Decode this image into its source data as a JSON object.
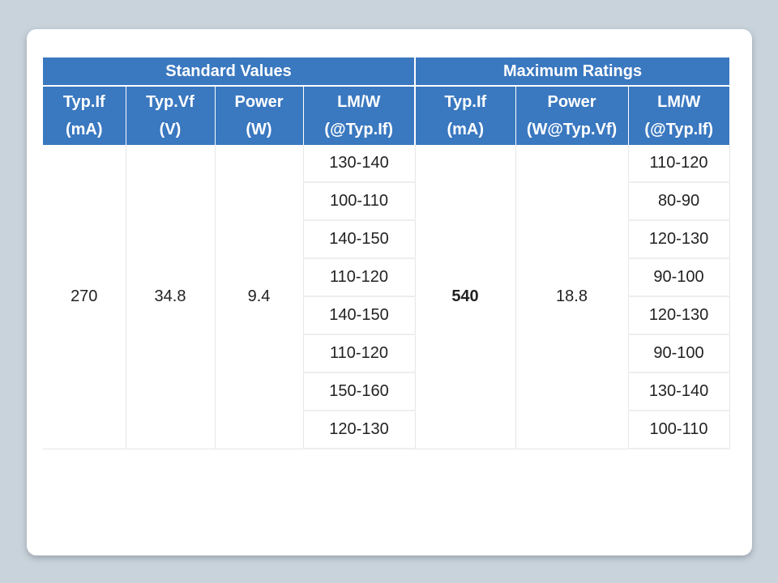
{
  "table": {
    "group_headers": [
      "Standard Values",
      "Maximum Ratings"
    ],
    "columns": [
      [
        "Typ.If",
        "(mA)"
      ],
      [
        "Typ.Vf",
        "(V)"
      ],
      [
        "Power",
        "(W)"
      ],
      [
        "LM/W",
        "(@Typ.If)"
      ],
      [
        "Typ.If",
        "(mA)"
      ],
      [
        "Power",
        "(W@Typ.Vf)"
      ],
      [
        "LM/W",
        "(@Typ.If)"
      ]
    ],
    "standard": {
      "typ_if": "270",
      "typ_vf": "34.8",
      "power": "9.4"
    },
    "maximum": {
      "typ_if": "540",
      "power": "18.8"
    },
    "rows": [
      {
        "std_lmw": "130-140",
        "max_lmw": "110-120"
      },
      {
        "std_lmw": "100-110",
        "max_lmw": "80-90"
      },
      {
        "std_lmw": "140-150",
        "max_lmw": "120-130"
      },
      {
        "std_lmw": "110-120",
        "max_lmw": "90-100"
      },
      {
        "std_lmw": "140-150",
        "max_lmw": "120-130"
      },
      {
        "std_lmw": "110-120",
        "max_lmw": "90-100"
      },
      {
        "std_lmw": "150-160",
        "max_lmw": "130-140"
      },
      {
        "std_lmw": "120-130",
        "max_lmw": "100-110"
      }
    ]
  }
}
